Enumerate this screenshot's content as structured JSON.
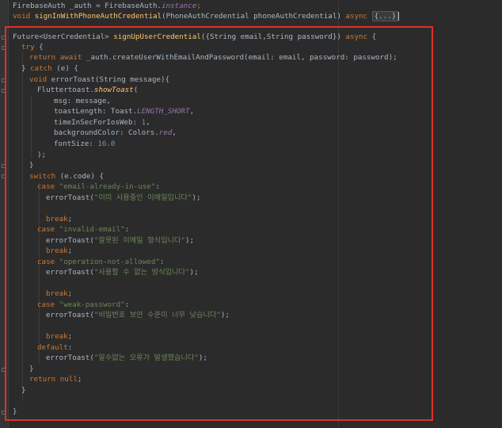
{
  "lines": {
    "l1": [
      "FirebaseAuth _auth = FirebaseAuth.",
      "instance",
      ";"
    ],
    "l2": [
      "void ",
      "signInWithPhoneAuthCredential",
      "(PhoneAuthCredential phoneAuthCredential) ",
      "async ",
      "{...}"
    ],
    "l3": [
      "Future<UserCredential> ",
      "signUpUserCredential",
      "({String email,String password}) ",
      "async",
      " {"
    ],
    "l4": [
      "try",
      " {"
    ],
    "l5": [
      "return await ",
      "_auth.createUserWithEmailAndPassword(email: email, password: password);"
    ],
    "l6": [
      "} ",
      "catch",
      " (e) {"
    ],
    "l7": [
      "void ",
      "errorToast",
      "(String message){"
    ],
    "l8": [
      "Fluttertoast.",
      "showToast",
      "("
    ],
    "l9": [
      "msg: message,"
    ],
    "l10": [
      "toastLength: Toast.",
      "LENGTH_SHORT",
      ","
    ],
    "l11": [
      "timeInSecForIosWeb: ",
      "1",
      ","
    ],
    "l12": [
      "backgroundColor: Colors.",
      "red",
      ","
    ],
    "l13": [
      "fontSize: ",
      "16.0"
    ],
    "l14": [
      ");"
    ],
    "l15": [
      "}"
    ],
    "l16": [
      "switch",
      " (e.code) {"
    ],
    "l17": [
      "case ",
      "\"email-already-in-use\"",
      ":"
    ],
    "l18": [
      "errorToast(",
      "\"이미 사용중인 이메일입니다\"",
      ");"
    ],
    "l20": [
      "break",
      ";"
    ],
    "l21": [
      "case ",
      "\"invalid-email\"",
      ":"
    ],
    "l22": [
      "errorToast(",
      "\"잘못된 이메일 형식입니다\"",
      ");"
    ],
    "l23": [
      "break",
      ";"
    ],
    "l24": [
      "case ",
      "\"operation-not-allowed\"",
      ":"
    ],
    "l25": [
      "errorToast(",
      "\"사용할 수 없는 방식입니다\"",
      ");"
    ],
    "l27": [
      "break",
      ";"
    ],
    "l28": [
      "case ",
      "\"weak-password\"",
      ":"
    ],
    "l29": [
      "errorToast(",
      "\"비밀번호 보안 수준이 너무 낮습니다\"",
      ");"
    ],
    "l31": [
      "break",
      ";"
    ],
    "l32": [
      "default",
      ":"
    ],
    "l33": [
      "errorToast(",
      "\"알수없는 오류가 발생했습니다\"",
      ");"
    ],
    "l34": [
      "}"
    ],
    "l35": [
      "return null",
      ";"
    ],
    "l36": [
      "}"
    ],
    "l38": [
      "}"
    ]
  },
  "colors": {
    "highlight_box": "#e03028",
    "keyword": "#cc7832",
    "function": "#ffc66d",
    "string": "#6a8759"
  }
}
